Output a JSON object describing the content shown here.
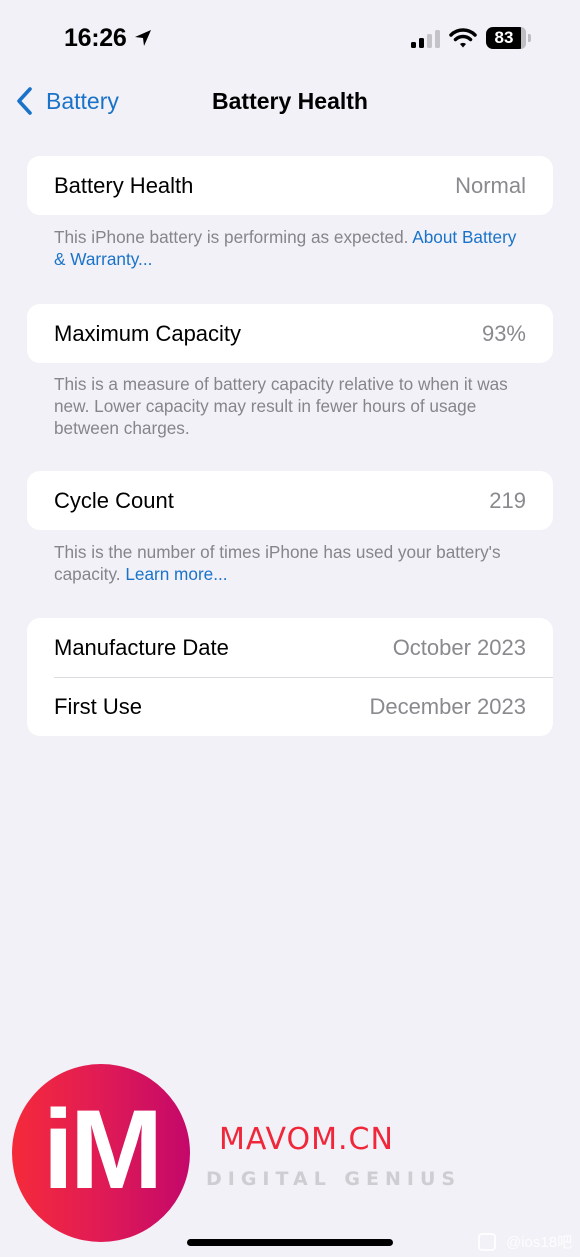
{
  "status_bar": {
    "time": "16:26",
    "location_icon": "location-arrow-icon",
    "signal_icon": "cellular-signal-icon",
    "signal_bars_active": 2,
    "signal_bars_total": 4,
    "wifi_icon": "wifi-icon",
    "battery_level": "83",
    "battery_percent": 83
  },
  "nav": {
    "back_label": "Battery",
    "back_icon": "chevron-left-icon",
    "title": "Battery Health"
  },
  "sections": [
    {
      "rows": [
        {
          "label": "Battery Health",
          "value": "Normal"
        }
      ],
      "footer_text": "This iPhone battery is performing as expected. ",
      "footer_link": "About Battery & Warranty..."
    },
    {
      "rows": [
        {
          "label": "Maximum Capacity",
          "value": "93%"
        }
      ],
      "footer_text": "This is a measure of battery capacity relative to when it was new. Lower capacity may result in fewer hours of usage between charges."
    },
    {
      "rows": [
        {
          "label": "Cycle Count",
          "value": "219"
        }
      ],
      "footer_text": "This is the number of times iPhone has used your battery's capacity. ",
      "footer_link": "Learn more..."
    },
    {
      "rows": [
        {
          "label": "Manufacture Date",
          "value": "October 2023"
        },
        {
          "label": "First Use",
          "value": "December 2023"
        }
      ]
    }
  ],
  "overlay": {
    "logo_letters": "iM",
    "brand_name": "MAVOM.CN",
    "brand_tagline": "DIGITAL GENIUS",
    "watermark": "@ios18吧"
  },
  "colors": {
    "accent": "#1a73c9",
    "background": "#f2f1f7",
    "secondary_text": "#8a8a8e",
    "brand_red": "#f0273a"
  }
}
